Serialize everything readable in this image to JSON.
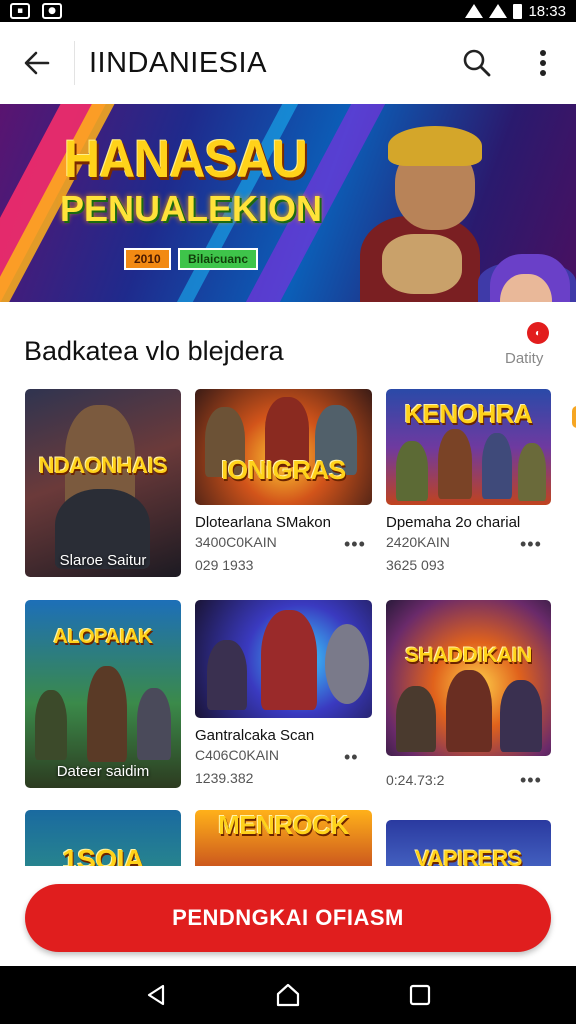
{
  "status_bar": {
    "time": "18:33",
    "left_icons": [
      "image-icon",
      "notification-icon"
    ]
  },
  "app_bar": {
    "title": "IINDANIESIA"
  },
  "banner": {
    "title": "HANASAU",
    "subtitle": "PENUALEKION",
    "chip_1": "2010",
    "chip_2": "Bilaicuanc"
  },
  "section": {
    "title": "Badkatea vlo blejdera",
    "link": "Datity"
  },
  "games": [
    {
      "logo": "NDAONHAIS",
      "caption": "Slaroe Saitur",
      "title": "",
      "meta1": "",
      "meta2": ""
    },
    {
      "logo": "IONIGRAS",
      "caption": "",
      "title": "Dlotearlana SMakon",
      "meta1": "3400C0KAIN",
      "meta2": "029 1933"
    },
    {
      "logo": "KENOHRA",
      "caption": "",
      "title": "Dpemaha 2o charial",
      "meta1": "2420KAIN",
      "meta2": "3625 093"
    },
    {
      "logo": "ALOPAIAK",
      "caption": "Dateer saidim",
      "title": "",
      "meta1": "",
      "meta2": ""
    },
    {
      "logo": "",
      "caption": "",
      "title": "Gantralcaka Scan",
      "meta1": "C406C0KAIN",
      "meta2": "1239.382"
    },
    {
      "logo": "SHADDIKAIN",
      "caption": "",
      "title": "",
      "meta1": "",
      "meta2": "0:24.73:2"
    },
    {
      "logo": "1SOIA",
      "caption": ""
    },
    {
      "logo": "MENROCK",
      "caption": ""
    },
    {
      "logo": "VAPIRERS",
      "caption": ""
    }
  ],
  "cta": {
    "label": "PENDNGKAI OFIASM"
  },
  "colors": {
    "accent": "#e01e1e",
    "logo_gold": "#ffd21a"
  }
}
